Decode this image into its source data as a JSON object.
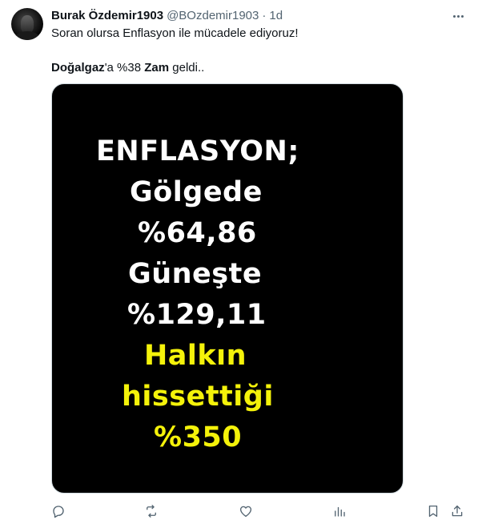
{
  "author": {
    "display_name": "Burak Özdemir1903",
    "handle": "@BOzdemir1903",
    "separator": "·",
    "time": "1d"
  },
  "body": {
    "line1": "Soran olursa Enflasyon ile mücadele ediyoruz!",
    "line2": {
      "part1": "Doğalgaz",
      "part2": "'a %38 ",
      "part3": "Zam",
      "part4": " geldi.."
    }
  },
  "media_text": {
    "l1": "ENFLASYON;",
    "l2": "Gölgede",
    "l3": "%64,86",
    "l4": "Güneşte",
    "l5": "%129,11",
    "l6": "Halkın",
    "l7": "hissettiği",
    "l8": "%350"
  },
  "colors": {
    "text_white": "#ffffff",
    "text_yellow": "#f4f20a",
    "muted": "#536471"
  },
  "icons": [
    "reply-icon",
    "retweet-icon",
    "like-icon",
    "views-icon",
    "bookmark-icon",
    "share-icon",
    "more-icon"
  ]
}
